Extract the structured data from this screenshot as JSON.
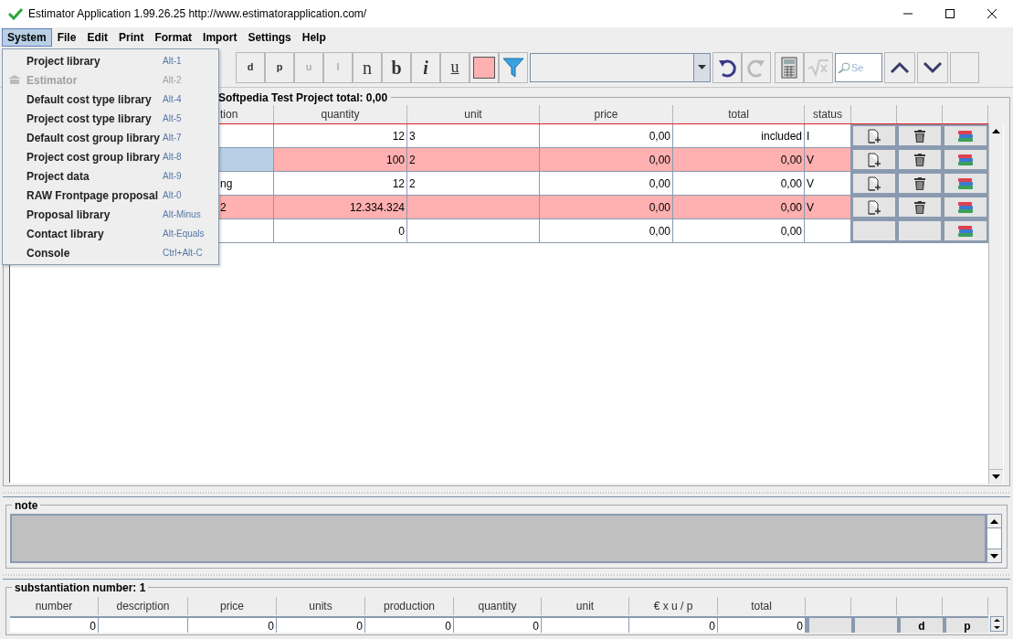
{
  "window": {
    "title": "Estimator Application 1.99.26.25 http://www.estimatorapplication.com/"
  },
  "menu_bar": [
    {
      "label": "System",
      "selected": true
    },
    {
      "label": "File",
      "selected": false
    },
    {
      "label": "Edit",
      "selected": false
    },
    {
      "label": "Print",
      "selected": false
    },
    {
      "label": "Format",
      "selected": false
    },
    {
      "label": "Import",
      "selected": false
    },
    {
      "label": "Settings",
      "selected": false
    },
    {
      "label": "Help",
      "selected": false
    }
  ],
  "system_menu": [
    {
      "label": "Project library",
      "shortcut": "Alt-1",
      "disabled": false
    },
    {
      "label": "Estimator",
      "shortcut": "Alt-2",
      "disabled": true
    },
    {
      "label": "Default cost type library",
      "shortcut": "Alt-4",
      "disabled": false
    },
    {
      "label": "Project cost type library",
      "shortcut": "Alt-5",
      "disabled": false
    },
    {
      "label": "Default cost group library",
      "shortcut": "Alt-7",
      "disabled": false
    },
    {
      "label": "Project cost group library",
      "shortcut": "Alt-8",
      "disabled": false
    },
    {
      "label": "Project data",
      "shortcut": "Alt-9",
      "disabled": false
    },
    {
      "label": "RAW Frontpage proposal",
      "shortcut": "Alt-0",
      "disabled": false
    },
    {
      "label": "Proposal library",
      "shortcut": "Alt-Minus",
      "disabled": false
    },
    {
      "label": "Contact library",
      "shortcut": "Alt-Equals",
      "disabled": false
    },
    {
      "label": "Console",
      "shortcut": "Ctrl+Alt-C",
      "disabled": false
    }
  ],
  "toolbar": [
    {
      "kind": "letter",
      "label": "d",
      "disabled": false
    },
    {
      "kind": "letter",
      "label": "p",
      "disabled": false
    },
    {
      "kind": "letter",
      "label": "u",
      "disabled": true
    },
    {
      "kind": "letter",
      "label": "I",
      "disabled": true
    },
    {
      "kind": "serif",
      "label": "n",
      "disabled": false
    },
    {
      "kind": "bold",
      "label": "b",
      "disabled": false
    },
    {
      "kind": "italic",
      "label": "i",
      "disabled": false
    },
    {
      "kind": "underline",
      "label": "u",
      "disabled": false
    },
    {
      "kind": "swatch",
      "disabled": false
    },
    {
      "kind": "filter",
      "disabled": false
    },
    {
      "kind": "combo",
      "disabled": false
    },
    {
      "kind": "undo",
      "disabled": false
    },
    {
      "kind": "redo",
      "disabled": true
    },
    {
      "kind": "calculator",
      "disabled": false
    },
    {
      "kind": "sqrt",
      "disabled": true
    },
    {
      "kind": "search",
      "placeholder": "Se",
      "disabled": false
    },
    {
      "kind": "up",
      "disabled": false
    },
    {
      "kind": "down",
      "disabled": false
    },
    {
      "kind": "blank",
      "disabled": false
    }
  ],
  "estimate": {
    "title": "Softpedia Test Project total: 0,00",
    "columns": [
      "tion",
      "quantity",
      "unit",
      "price",
      "total",
      "status"
    ],
    "rows": [
      {
        "quantity": "12",
        "unit": "3",
        "price": "0,00",
        "total": "included",
        "status": "I",
        "highlighted": false,
        "selected": false,
        "actions": [
          {
            "kind": "add"
          },
          {
            "kind": "delete"
          },
          {
            "kind": "stack"
          }
        ]
      },
      {
        "quantity": "100",
        "unit": "2",
        "price": "0,00",
        "total": "0,00",
        "status": "V",
        "highlighted": true,
        "selected": true,
        "actions": [
          {
            "kind": "add"
          },
          {
            "kind": "delete"
          },
          {
            "kind": "stack"
          }
        ]
      },
      {
        "description": "ng",
        "quantity": "12",
        "unit": "2",
        "price": "0,00",
        "total": "0,00",
        "status": "V",
        "highlighted": false,
        "selected": false,
        "actions": [
          {
            "kind": "add"
          },
          {
            "kind": "delete"
          },
          {
            "kind": "stack"
          }
        ]
      },
      {
        "description": "2",
        "quantity": "12.334.324",
        "price": "0,00",
        "total": "0,00",
        "status": "V",
        "highlighted": true,
        "selected": false,
        "actions": [
          {
            "kind": "add"
          },
          {
            "kind": "delete"
          },
          {
            "kind": "stack"
          }
        ]
      },
      {
        "quantity": "0",
        "price": "0,00",
        "total": "0,00",
        "highlighted": false,
        "selected": false,
        "actions": [
          {
            "kind": "blank"
          },
          {
            "kind": "blank"
          },
          {
            "kind": "stack"
          }
        ]
      }
    ]
  },
  "note": {
    "title": "note"
  },
  "substantiation": {
    "title": "substantiation number: 1",
    "columns": [
      "number",
      "description",
      "price",
      "units",
      "production",
      "quantity",
      "unit",
      "€ x u / p",
      "total"
    ],
    "row": {
      "number": "0",
      "price": "0",
      "units": "0",
      "production": "0",
      "quantity": "0",
      "eur_x_u_p": "0",
      "total": "0"
    },
    "buttons": [
      "d",
      "p"
    ]
  }
}
